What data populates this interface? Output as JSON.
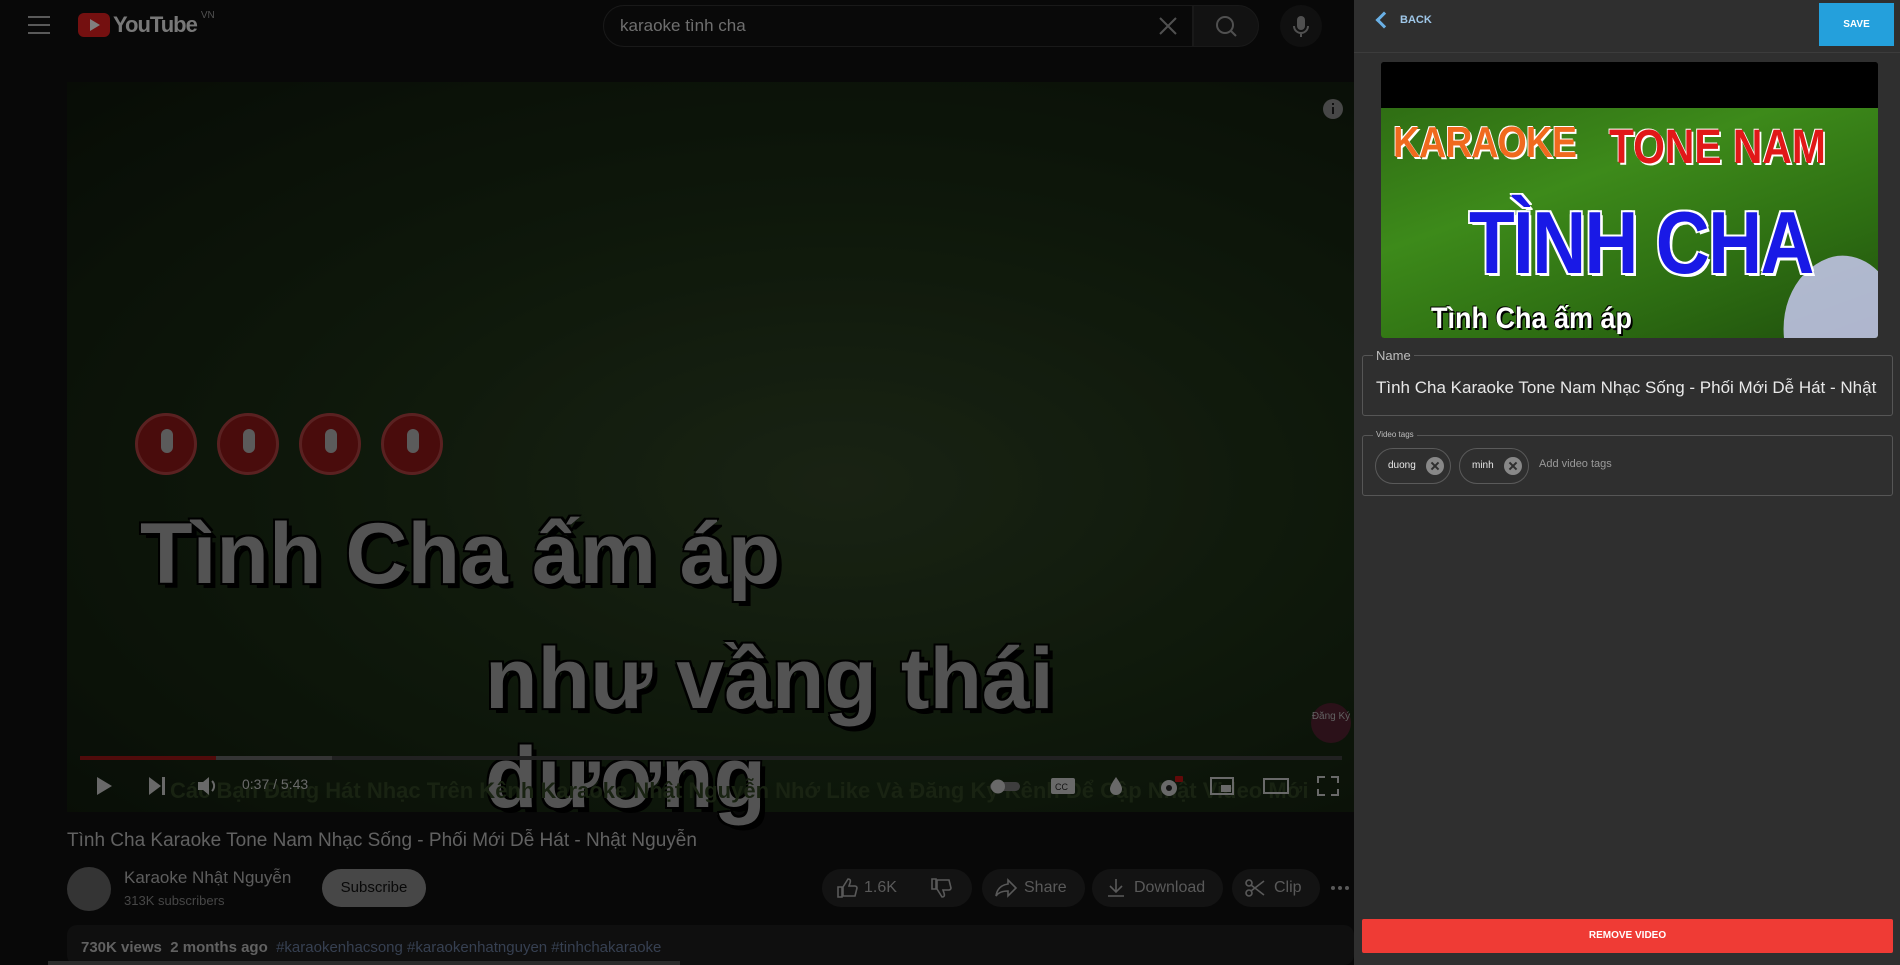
{
  "youtube": {
    "logo_text": "YouTube",
    "country_code": "VN",
    "search_query": "karaoke tình cha",
    "lyrics_line1": "Tình Cha ấm áp",
    "lyrics_line2": "như vầng thái dương",
    "marquee": "Các Bạn Đăng Hát Nhạc Trên Kênh Karaoke Nhật Nguyễn Nhớ Like Và Đăng Ký Kênh Để Cập Nhật Video Mới",
    "subscribe_badge": "Đăng Ký",
    "progress_fraction": 0.108,
    "buffered_fraction": 0.2,
    "time": "0:37 / 5:43",
    "video_title": "Tình Cha Karaoke Tone Nam Nhạc Sống - Phối Mới Dễ Hát - Nhật Nguyễn",
    "channel_name": "Karaoke Nhật Nguyễn",
    "subscribers": "313K subscribers",
    "subscribe_label": "Subscribe",
    "like_count": "1.6K",
    "share_label": "Share",
    "download_label": "Download",
    "clip_label": "Clip",
    "views": "730K views",
    "posted": "2 months ago",
    "hashtags": "#karaokenhacsong #karaokenhatnguyen #tinhchakaraoke"
  },
  "panel": {
    "back_label": "BACK",
    "save_label": "SAVE",
    "thumbnail": {
      "line_karaoke": "KARAOKE",
      "line_tone": "TONE NAM",
      "line_title": "TÌNH CHA",
      "line_sub": "Tình Cha ấm áp"
    },
    "name_label": "Name",
    "name_value": "Tình Cha Karaoke Tone Nam Nhạc Sống - Phối Mới Dễ Hát - Nhật Nguyễn",
    "tags_label": "Video tags",
    "tags": [
      "duong",
      "minh"
    ],
    "tags_placeholder": "Add video tags",
    "remove_label": "REMOVE VIDEO"
  }
}
